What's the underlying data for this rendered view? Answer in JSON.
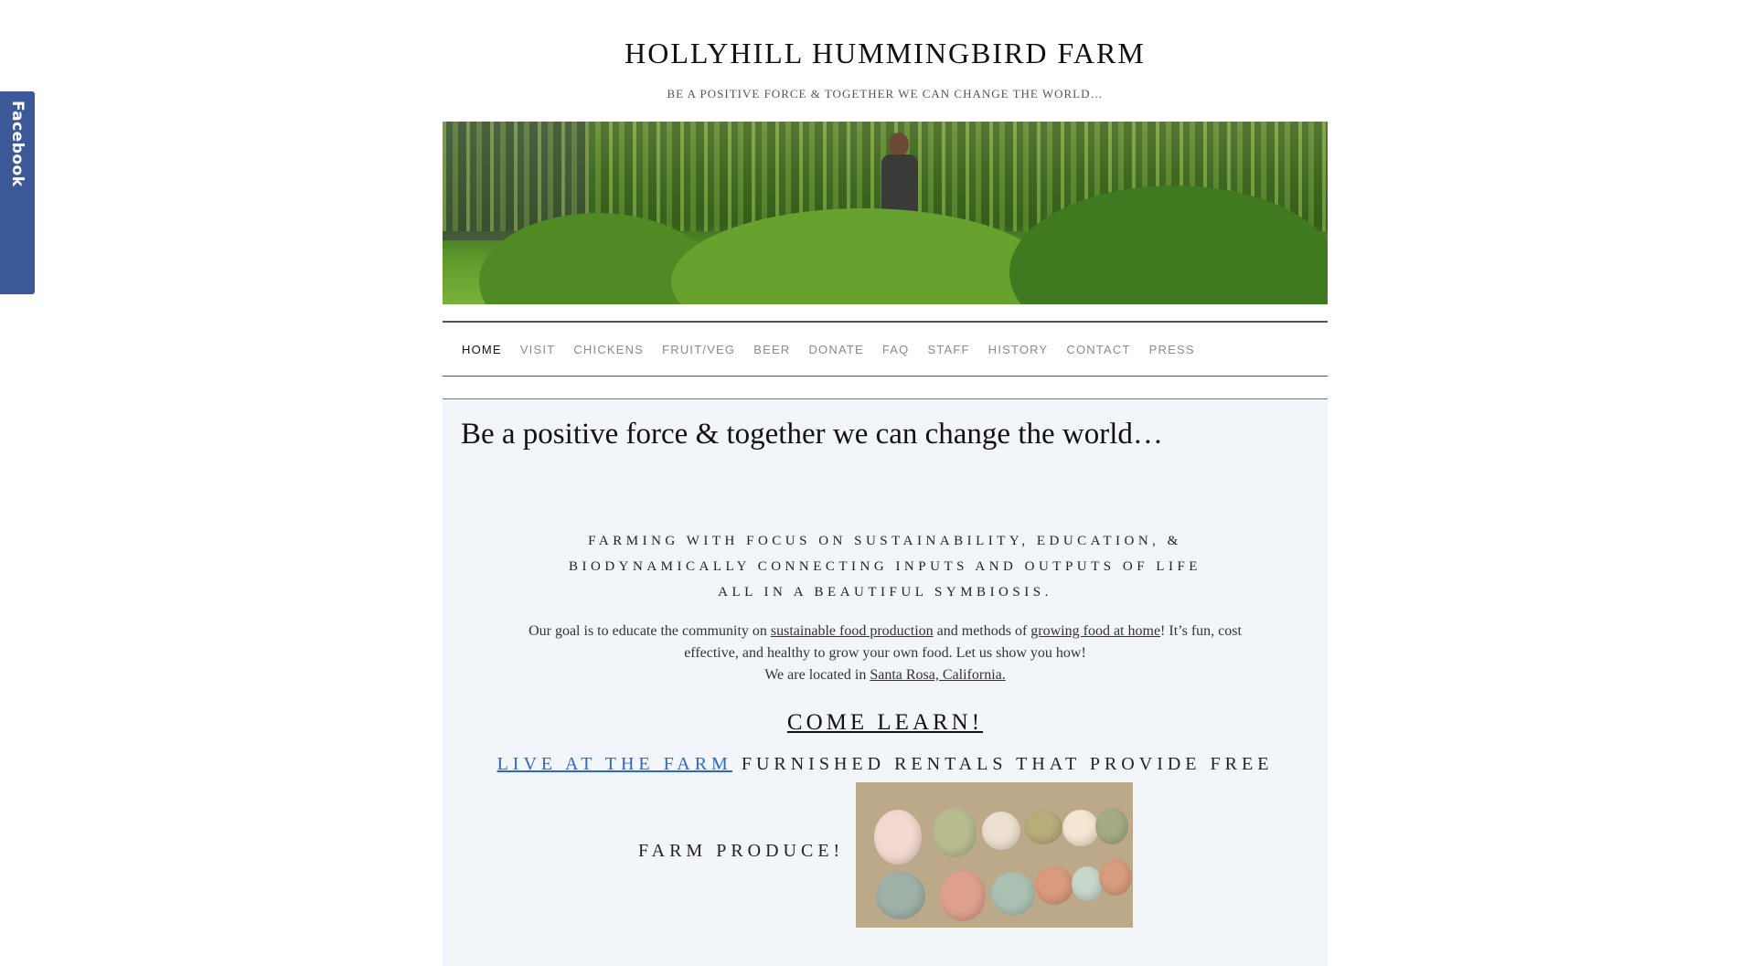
{
  "facebook_tab": {
    "label": "Facebook"
  },
  "site": {
    "title": "HOLLYHILL HUMMINGBIRD FARM",
    "tagline": "BE A POSITIVE FORCE & TOGETHER WE CAN CHANGE THE WORLD…"
  },
  "nav": {
    "items": [
      "HOME",
      "VISIT",
      "CHICKENS",
      "FRUIT/VEG",
      "BEER",
      "DONATE",
      "FAQ",
      "STAFF",
      "HISTORY",
      "CONTACT",
      "PRESS"
    ],
    "active": "HOME"
  },
  "content": {
    "heading": "Be a positive force & together we can change the world…",
    "lead_lines": [
      "FARMING WITH FOCUS ON SUSTAINABILITY, EDUCATION, &",
      "BIODYNAMICALLY CONNECTING INPUTS AND OUTPUTS OF LIFE",
      "ALL IN A BEAUTIFUL SYMBIOSIS."
    ],
    "goal": {
      "p1": "Our goal is to educate the community on ",
      "link1": "sustainable food production",
      "p2": " and methods of ",
      "link2": "growing food at home",
      "p3": "! It’s fun, cost",
      "line2": "effective, and healthy to grow your own food. Let us show you how!",
      "location_prefix": "We are located in ",
      "location_link": "Santa Rosa, California."
    },
    "come_learn": "COME LEARN!",
    "rental": {
      "link": "LIVE AT THE FARM",
      "text": " FURNISHED RENTALS THAT PROVIDE FREE",
      "line2": "FARM PRODUCE!"
    }
  }
}
